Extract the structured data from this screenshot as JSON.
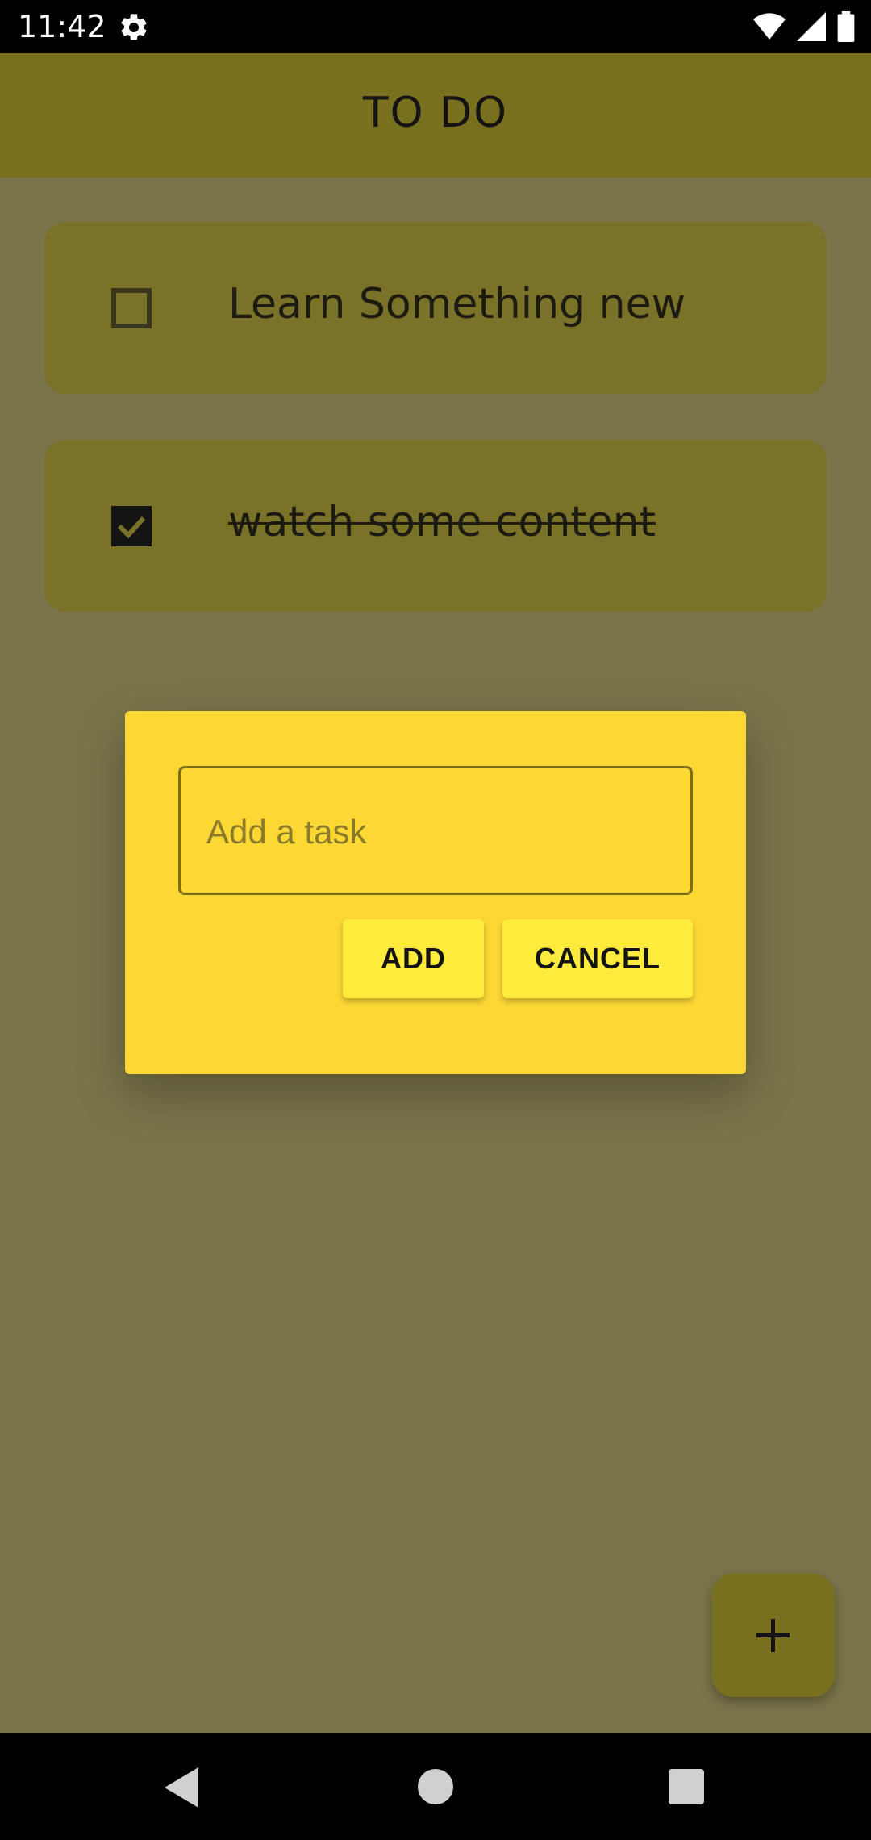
{
  "status_bar": {
    "time": "11:42",
    "icons": [
      "settings-icon",
      "wifi-icon",
      "signal-icon",
      "battery-icon"
    ]
  },
  "app_bar": {
    "title": "TO DO"
  },
  "tasks": [
    {
      "label": "Learn Something new",
      "checked": false
    },
    {
      "label": "watch some content",
      "checked": true
    }
  ],
  "dialog": {
    "input_placeholder": "Add a task",
    "input_value": "",
    "add_label": "ADD",
    "cancel_label": "CANCEL"
  },
  "fab": {
    "icon": "plus-icon"
  },
  "colors": {
    "app_bar": "#79701f",
    "dialog": "#fdd835",
    "button": "#ffeb3b",
    "scrim_background": "#7a744a"
  }
}
